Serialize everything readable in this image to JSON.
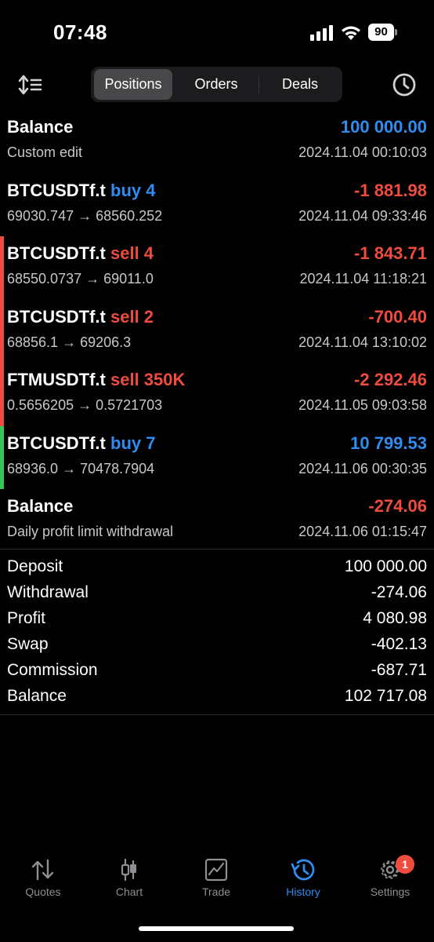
{
  "status_bar": {
    "time": "07:48",
    "battery": "90"
  },
  "segments": [
    {
      "label": "Positions",
      "active": true
    },
    {
      "label": "Orders",
      "active": false
    },
    {
      "label": "Deals",
      "active": false
    }
  ],
  "rows": [
    {
      "title": "Balance",
      "side": "",
      "subtitle": "Custom edit",
      "amount": "100 000.00",
      "amount_color": "blue",
      "time": "2024.11.04 00:10:03",
      "bar": ""
    },
    {
      "title": "BTCUSDTf.t",
      "side": "buy 4",
      "side_color": "blue",
      "subtitle": "69030.747 → 68560.252",
      "amount": "-1 881.98",
      "amount_color": "red",
      "time": "2024.11.04 09:33:46",
      "bar": ""
    },
    {
      "title": "BTCUSDTf.t",
      "side": "sell 4",
      "side_color": "red",
      "subtitle": "68550.0737 → 69011.0",
      "amount": "-1 843.71",
      "amount_color": "red",
      "time": "2024.11.04 11:18:21",
      "bar": "#ef4b3f"
    },
    {
      "title": "BTCUSDTf.t",
      "side": "sell 2",
      "side_color": "red",
      "subtitle": "68856.1 → 69206.3",
      "amount": "-700.40",
      "amount_color": "red",
      "time": "2024.11.04 13:10:02",
      "bar": "#ef4b3f"
    },
    {
      "title": "FTMUSDTf.t",
      "side": "sell 350K",
      "side_color": "red",
      "subtitle": "0.5656205 → 0.5721703",
      "amount": "-2 292.46",
      "amount_color": "red",
      "time": "2024.11.05 09:03:58",
      "bar": "#ef4b3f"
    },
    {
      "title": "BTCUSDTf.t",
      "side": "buy 7",
      "side_color": "blue",
      "subtitle": "68936.0 → 70478.7904",
      "amount": "10 799.53",
      "amount_color": "blue",
      "time": "2024.11.06 00:30:35",
      "bar": "#34c759"
    },
    {
      "title": "Balance",
      "side": "",
      "subtitle": "Daily profit limit withdrawal",
      "amount": "-274.06",
      "amount_color": "red",
      "time": "2024.11.06 01:15:47",
      "bar": ""
    }
  ],
  "summary": [
    {
      "label": "Deposit",
      "value": "100 000.00"
    },
    {
      "label": "Withdrawal",
      "value": "-274.06"
    },
    {
      "label": "Profit",
      "value": "4 080.98"
    },
    {
      "label": "Swap",
      "value": "-402.13"
    },
    {
      "label": "Commission",
      "value": "-687.71"
    },
    {
      "label": "Balance",
      "value": "102 717.08"
    }
  ],
  "tabs": [
    {
      "label": "Quotes",
      "icon": "quotes-icon",
      "active": false
    },
    {
      "label": "Chart",
      "icon": "chart-icon",
      "active": false
    },
    {
      "label": "Trade",
      "icon": "trade-icon",
      "active": false
    },
    {
      "label": "History",
      "icon": "history-icon",
      "active": true
    },
    {
      "label": "Settings",
      "icon": "settings-icon",
      "active": false,
      "badge": "1"
    }
  ],
  "colors": {
    "blue": "#2f8cf0",
    "red": "#ef4b3f",
    "green": "#34c759"
  }
}
